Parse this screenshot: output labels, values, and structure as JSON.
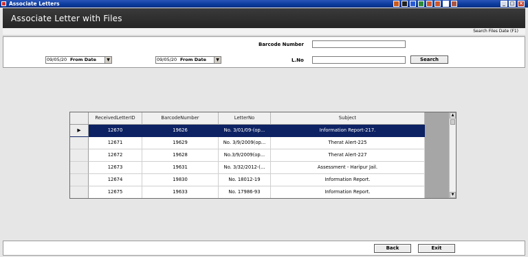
{
  "window": {
    "title": "Associate Letters"
  },
  "banner": {
    "title": "Associate Letter with Files"
  },
  "subbar": {
    "shortcut_hint": "Search Files Date (F1)"
  },
  "filters": {
    "barcode_label": "Barcode Number",
    "barcode_value": "",
    "lno_label": "L.No",
    "lno_value": "",
    "search_label": "Search",
    "from_date_1": {
      "value": "09/05/20",
      "label": "From Date"
    },
    "from_date_2": {
      "value": "09/05/20",
      "label": "From Date"
    }
  },
  "grid": {
    "columns": [
      "ReceivedLetterID",
      "BarcodeNumber",
      "LetterNo",
      "Subject"
    ],
    "selected_marker": "▶",
    "rows": [
      {
        "received_letter_id": "12670",
        "barcode_number": "19626",
        "letter_no": "No. 3/01/09-(op...",
        "subject": "Information Report-217."
      },
      {
        "received_letter_id": "12671",
        "barcode_number": "19629",
        "letter_no": "No. 3/9/2009(op...",
        "subject": "Therat Alert-225"
      },
      {
        "received_letter_id": "12672",
        "barcode_number": "19628",
        "letter_no": "No.3/9/2009(op...",
        "subject": "Therat Alert-227"
      },
      {
        "received_letter_id": "12673",
        "barcode_number": "19631",
        "letter_no": "No. 3/32/2012-(...",
        "subject": "Assessment - Haripur Jail."
      },
      {
        "received_letter_id": "12674",
        "barcode_number": "19830",
        "letter_no": "No. 18012-19",
        "subject": "Information Report."
      },
      {
        "received_letter_id": "12675",
        "barcode_number": "19633",
        "letter_no": "No. 17986-93",
        "subject": "Information Report."
      }
    ]
  },
  "footer": {
    "back_label": "Back",
    "exit_label": "Exit"
  },
  "colors": {
    "selection": "#0d2263",
    "titlebar": "#0a3a9c",
    "banner": "#2b2b2b"
  }
}
